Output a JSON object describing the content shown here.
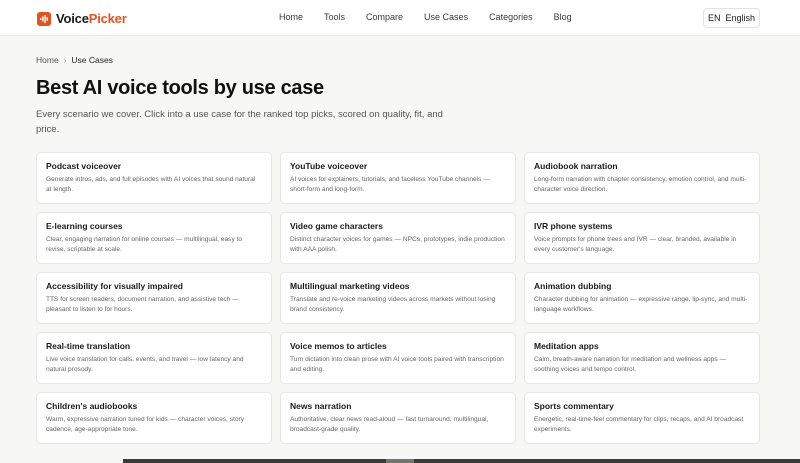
{
  "brand": {
    "name_part1": "Voice",
    "name_part2": "Picker",
    "accent": "#e2531e"
  },
  "nav": {
    "links": [
      "Home",
      "Tools",
      "Compare",
      "Use Cases",
      "Categories",
      "Blog"
    ]
  },
  "language": {
    "code": "EN",
    "label": "English"
  },
  "breadcrumb": {
    "home": "Home",
    "current": "Use Cases"
  },
  "page": {
    "title": "Best AI voice tools by use case",
    "intro": "Every scenario we cover. Click into a use case for the ranked top picks, scored on quality, fit, and price."
  },
  "cards": [
    {
      "title": "Podcast voiceover",
      "desc": "Generate intros, ads, and full episodes with AI voices that sound natural at length."
    },
    {
      "title": "YouTube voiceover",
      "desc": "AI voices for explainers, tutorials, and faceless YouTube channels — short-form and long-form."
    },
    {
      "title": "Audiobook narration",
      "desc": "Long-form narration with chapter consistency, emotion control, and multi-character voice direction."
    },
    {
      "title": "E-learning courses",
      "desc": "Clear, engaging narration for online courses — multilingual, easy to revise, scriptable at scale."
    },
    {
      "title": "Video game characters",
      "desc": "Distinct character voices for games — NPCs, prototypes, indie production with AAA polish."
    },
    {
      "title": "IVR phone systems",
      "desc": "Voice prompts for phone trees and IVR — clear, branded, available in every customer's language."
    },
    {
      "title": "Accessibility for visually impaired",
      "desc": "TTS for screen readers, document narration, and assistive tech — pleasant to listen to for hours."
    },
    {
      "title": "Multilingual marketing videos",
      "desc": "Translate and re-voice marketing videos across markets without losing brand consistency."
    },
    {
      "title": "Animation dubbing",
      "desc": "Character dubbing for animation — expressive range, lip-sync, and multi-language workflows."
    },
    {
      "title": "Real-time translation",
      "desc": "Live voice translation for calls, events, and travel — low latency and natural prosody."
    },
    {
      "title": "Voice memos to articles",
      "desc": "Turn dictation into clean prose with AI voice tools paired with transcription and editing."
    },
    {
      "title": "Meditation apps",
      "desc": "Calm, breath-aware narration for meditation and wellness apps — soothing voices and tempo control."
    },
    {
      "title": "Children's audiobooks",
      "desc": "Warm, expressive narration tuned for kids — character voices, story cadence, age-appropriate tone."
    },
    {
      "title": "News narration",
      "desc": "Authoritative, clear news read-aloud — fast turnaround, multilingual, broadcast-grade quality."
    },
    {
      "title": "Sports commentary",
      "desc": "Energetic, real-time-feel commentary for clips, recaps, and AI broadcast experiments."
    }
  ]
}
